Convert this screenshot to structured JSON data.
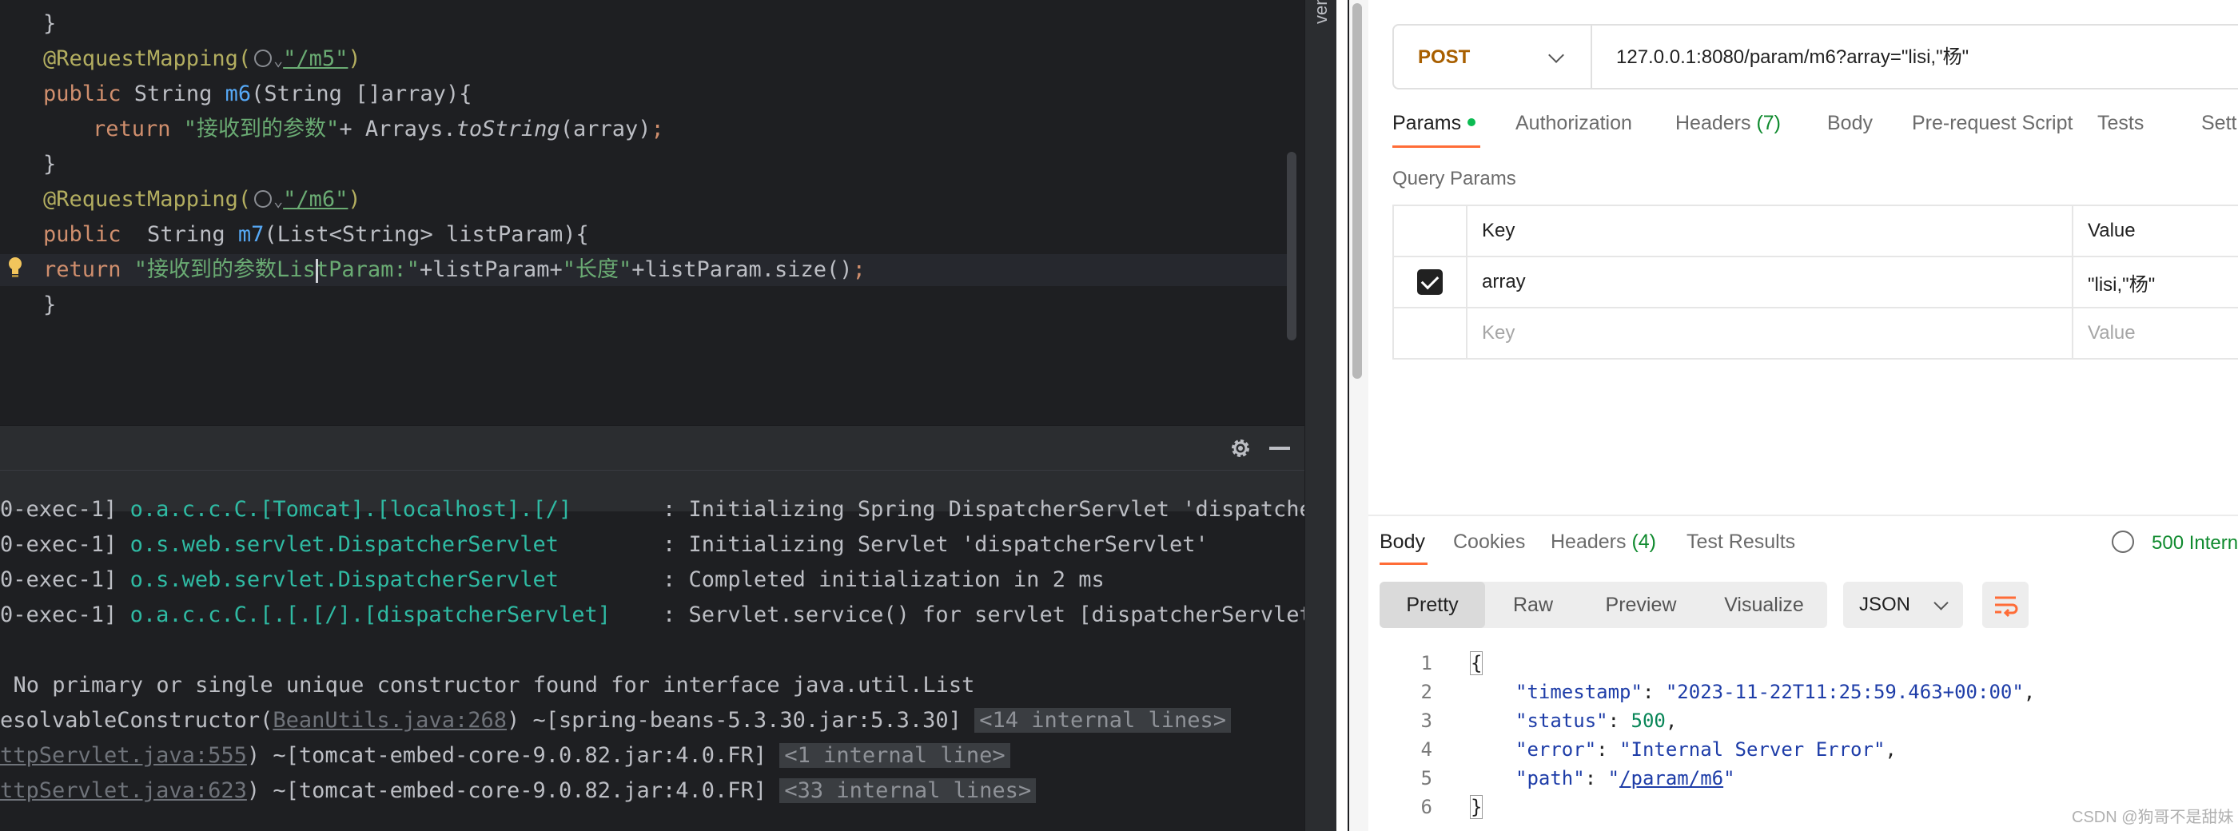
{
  "ide": {
    "side_strip_label": "ven",
    "code": {
      "l1_brace": "}",
      "l2_annotation": "@RequestMapping(",
      "l2_path": "\"/m5\"",
      "l2_close": ")",
      "l3_public": "public",
      "l3_type": " String ",
      "l3_method": "m6",
      "l3_params": "(String []array){",
      "l4_return": "return",
      "l4_str": " \"接收到的参数\"",
      "l4_plus": "+ Arrays.",
      "l4_call": "toString",
      "l4_args": "(array)",
      "l4_semi": ";",
      "l5_brace": "}",
      "l6_annotation": "@RequestMapping(",
      "l6_path": "\"/m6\"",
      "l6_close": ")",
      "l7_public": "public",
      "l7_type": "  String ",
      "l7_method": "m7",
      "l7_params": "(List<String> listParam){",
      "l8_return": "return",
      "l8_str1": " \"接收到的参数List",
      "l8_str1b": "Param:\"",
      "l8_mid": "+listParam+",
      "l8_str2": "\"长度\"",
      "l8_tail": "+listParam.size()",
      "l8_semi": ";",
      "l9_brace": "}"
    },
    "console": {
      "l1_thread": "0-exec-1] ",
      "l1_logger": "o.a.c.c.C.[Tomcat].[localhost].[/]      ",
      "l1_msg": " : Initializing Spring DispatcherServlet 'dispatcherServlet'",
      "l2_thread": "0-exec-1] ",
      "l2_logger": "o.s.web.servlet.DispatcherServlet       ",
      "l2_msg": " : Initializing Servlet 'dispatcherServlet'",
      "l3_thread": "0-exec-1] ",
      "l3_logger": "o.s.web.servlet.DispatcherServlet       ",
      "l3_msg": " : Completed initialization in 2 ms",
      "l4_thread": "0-exec-1] ",
      "l4_logger": "o.a.c.c.C.[.[.[/].[dispatcherServlet]   ",
      "l4_msg": " : Servlet.service() for servlet [dispatcherServlet] in",
      "l5": ": No primary or single unique constructor found for interface java.util.List",
      "l6_pre": "esolvableConstructor(",
      "l6_link": "BeanUtils.java:268",
      "l6_post": ") ~[spring-beans-5.3.30.jar:5.3.30] ",
      "l6_fold": "<14 internal lines>",
      "l7_link": "ttpServlet.java:555",
      "l7_post": ") ~[tomcat-embed-core-9.0.82.jar:4.0.FR] ",
      "l7_fold": "<1 internal line>",
      "l8_link": "ttpServlet.java:623",
      "l8_post": ") ~[tomcat-embed-core-9.0.82.jar:4.0.FR] ",
      "l8_fold": "<33 internal lines>"
    }
  },
  "postman": {
    "method": "POST",
    "url": "127.0.0.1:8080/param/m6?array=\"lisi,\"杨\"",
    "request_tabs": {
      "params": "Params",
      "authorization": "Authorization",
      "headers": "Headers",
      "headers_count": "(7)",
      "body": "Body",
      "prerequest": "Pre-request Script",
      "tests": "Tests",
      "settings": "Sett"
    },
    "query_params_title": "Query Params",
    "table": {
      "key_header": "Key",
      "value_header": "Value",
      "row_key": "array",
      "row_value": "\"lisi,\"杨\"",
      "placeholder_key": "Key",
      "placeholder_value": "Value"
    },
    "response_tabs": {
      "body": "Body",
      "cookies": "Cookies",
      "headers": "Headers",
      "headers_count": "(4)",
      "test_results": "Test Results"
    },
    "status": "500 Intern",
    "view_modes": {
      "pretty": "Pretty",
      "raw": "Raw",
      "preview": "Preview",
      "visualize": "Visualize"
    },
    "format": "JSON",
    "response_json": {
      "open": "{",
      "timestamp_key": "\"timestamp\"",
      "timestamp_val": "\"2023-11-22T11:25:59.463+00:00\"",
      "status_key": "\"status\"",
      "status_val": "500",
      "error_key": "\"error\"",
      "error_val": "\"Internal Server Error\"",
      "path_key": "\"path\"",
      "path_q1": "\"",
      "path_val": "/param/m6",
      "path_q2": "\"",
      "close": "}"
    },
    "line_numbers": [
      "1",
      "2",
      "3",
      "4",
      "5",
      "6"
    ],
    "watermark": "CSDN @狗哥不是甜妹"
  }
}
